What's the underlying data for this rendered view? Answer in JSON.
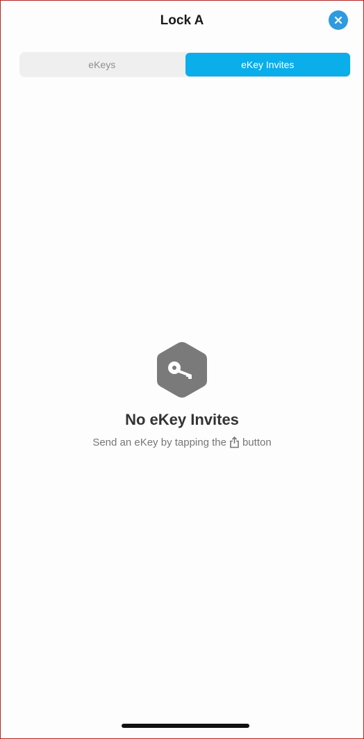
{
  "header": {
    "title": "Lock A",
    "close_icon": "close-icon"
  },
  "tabs": [
    {
      "label": "eKeys",
      "selected": false
    },
    {
      "label": "eKey Invites",
      "selected": true
    }
  ],
  "empty_state": {
    "icon": "key-icon",
    "title": "No eKey Invites",
    "subtitle_before": "Send an eKey by tapping the",
    "subtitle_icon": "share-icon",
    "subtitle_after": "button"
  },
  "colors": {
    "accent": "#09AEEA",
    "close_button": "#2E9BDE",
    "icon_gray": "#7A7A7A"
  }
}
